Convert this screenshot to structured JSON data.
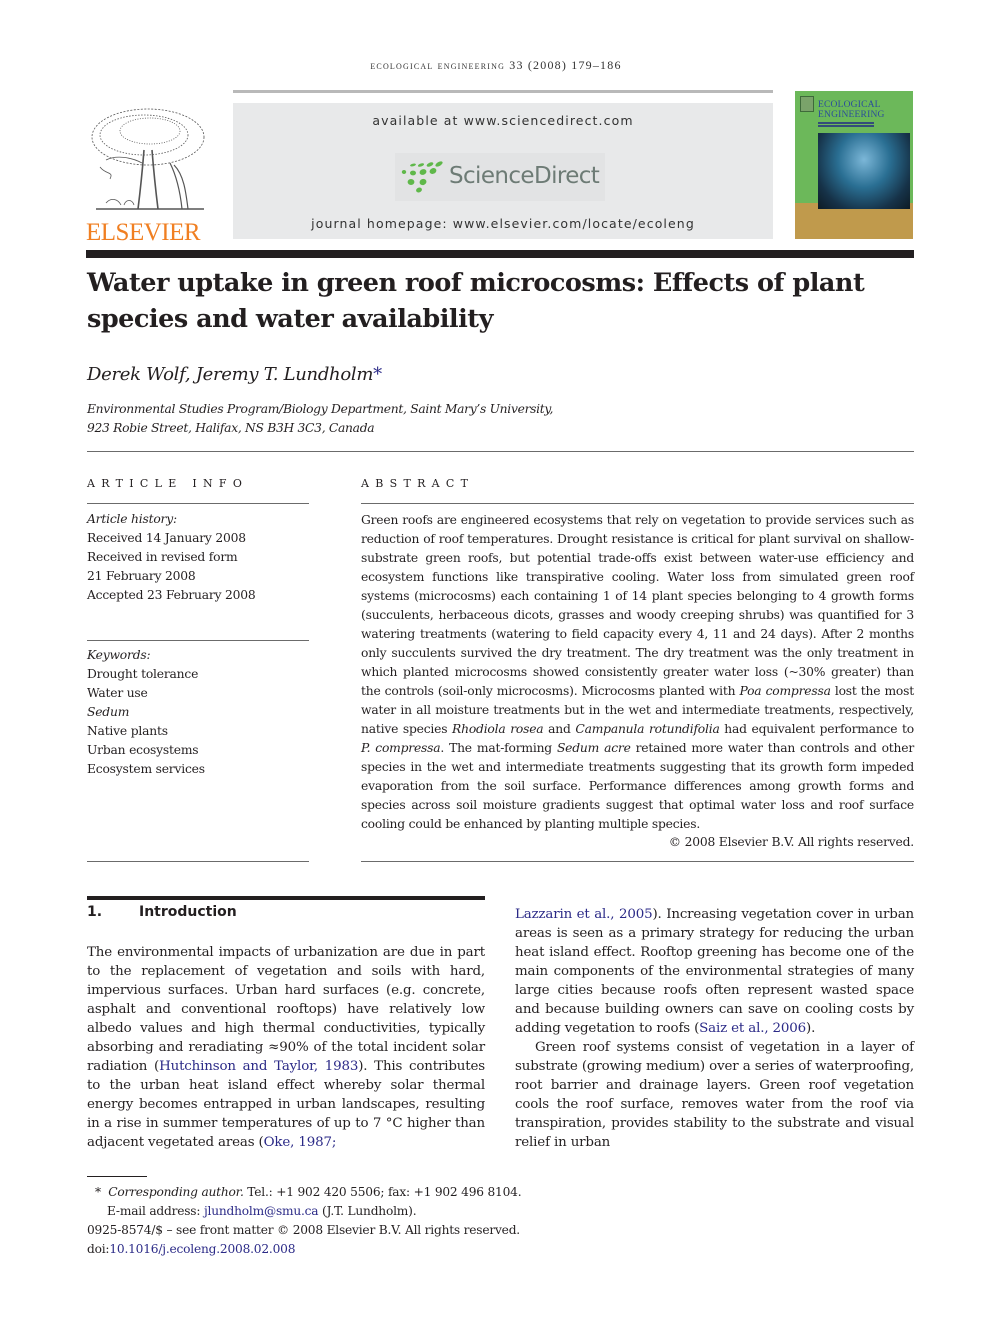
{
  "running_header": {
    "journal": "ecological engineering",
    "volume_info": "33 (2008) 179–186"
  },
  "banner": {
    "available_at": "available at www.sciencedirect.com",
    "sciencedirect_logo": "ScienceDirect",
    "journal_homepage": "journal homepage: www.elsevier.com/locate/ecoleng",
    "publisher_logo": "ELSEVIER",
    "cover": {
      "title_line1": "ECOLOGICAL",
      "title_line2": "ENGINEERING"
    },
    "colors": {
      "elsevier_orange": "#f07f22",
      "sciencedirect_green": "#5fb84a",
      "sciencedirect_gray": "#6d7b75",
      "link_blue": "#2b2a87"
    }
  },
  "article": {
    "title": "Water uptake in green roof microcosms: Effects of plant species and water availability",
    "authors": "Derek Wolf, Jeremy T. Lundholm",
    "corresponding_marker": "*",
    "affiliation_line1": "Environmental Studies Program/Biology Department, Saint Mary’s University,",
    "affiliation_line2": "923 Robie Street, Halifax, NS B3H 3C3, Canada"
  },
  "article_info": {
    "heading": "ARTICLE INFO",
    "history_label": "Article history:",
    "history": [
      "Received 14 January 2008",
      "Received in revised form",
      "21 February 2008",
      "Accepted 23 February 2008"
    ],
    "keywords_label": "Keywords:",
    "keywords": [
      {
        "text": "Drought tolerance",
        "italic": false
      },
      {
        "text": "Water use",
        "italic": false
      },
      {
        "text": "Sedum",
        "italic": true
      },
      {
        "text": "Native plants",
        "italic": false
      },
      {
        "text": "Urban ecosystems",
        "italic": false
      },
      {
        "text": "Ecosystem services",
        "italic": false
      }
    ]
  },
  "abstract": {
    "heading": "ABSTRACT",
    "p1": "Green roofs are engineered ecosystems that rely on vegetation to provide services such as reduction of roof temperatures. Drought resistance is critical for plant survival on shallow-substrate green roofs, but potential trade-offs exist between water-use efficiency and ecosystem functions like transpirative cooling. Water loss from simulated green roof systems (microcosms) each containing 1 of 14 plant species belonging to 4 growth forms (succulents, herbaceous dicots, grasses and woody creeping shrubs) was quantified for 3 watering treatments (watering to field capacity every 4, 11 and 24 days). After 2 months only succulents survived the dry treatment. The dry treatment was the only treatment in which planted microcosms showed consistently greater water loss (~30% greater) than the controls (soil-only microcosms). Microcosms planted with ",
    "sp1": "Poa compressa",
    "p2": " lost the most water in all moisture treatments but in the wet and intermediate treatments, respectively, native species ",
    "sp2": "Rhodiola rosea",
    "p3": " and ",
    "sp3": "Campanula rotundifolia",
    "p4": " had equivalent performance to ",
    "sp4": "P. compressa",
    "p5": ". The mat-forming ",
    "sp5": "Sedum acre",
    "p6": " retained more water than controls and other species in the wet and intermediate treatments suggesting that its growth form impeded evaporation from the soil surface. Performance differences among growth forms and species across soil moisture gradients suggest that optimal water loss and roof surface cooling could be enhanced by planting multiple species.",
    "copyright": "© 2008 Elsevier B.V. All rights reserved."
  },
  "introduction": {
    "number": "1.",
    "heading": "Introduction",
    "left": {
      "t1": "The environmental impacts of urbanization are due in part to the replacement of vegetation and soils with hard, impervious surfaces. Urban hard surfaces (e.g. concrete, asphalt and conventional rooftops) have relatively low albedo values and high thermal conductivities, typically absorbing and reradiating ≈90% of the total incident solar radiation (",
      "c1": "Hutchinson and Taylor, 1983",
      "t2": "). This contributes to the urban heat island effect whereby solar thermal energy becomes entrapped in urban landscapes, resulting in a rise in summer temperatures of up to 7 °C higher than adjacent vegetated areas (",
      "c2": "Oke, 1987;"
    },
    "right": {
      "c3": "Lazzarin et al., 2005",
      "t3": "). Increasing vegetation cover in urban areas is seen as a primary strategy for reducing the urban heat island effect. Rooftop greening has become one of the main components of the environmental strategies of many large cities because roofs often represent wasted space and because building owners can save on cooling costs by adding vegetation to roofs (",
      "c4": "Saiz et al., 2006",
      "t4": ").",
      "p2": "Green roof systems consist of vegetation in a layer of substrate (growing medium) over a series of waterproofing, root barrier and drainage layers. Green roof vegetation cools the roof surface, removes water from the roof via transpiration, provides stability to the substrate and visual relief in urban"
    }
  },
  "footnotes": {
    "marker": "*",
    "corresponding_label": "Corresponding author.",
    "contact": " Tel.: +1 902 420 5506; fax: +1 902 496 8104.",
    "email_label": "E-mail address: ",
    "email": "jlundholm@smu.ca",
    "email_suffix": " (J.T. Lundholm).",
    "issn_line": "0925-8574/$ – see front matter © 2008 Elsevier B.V. All rights reserved.",
    "doi_label": "doi:",
    "doi": "10.1016/j.ecoleng.2008.02.008"
  }
}
